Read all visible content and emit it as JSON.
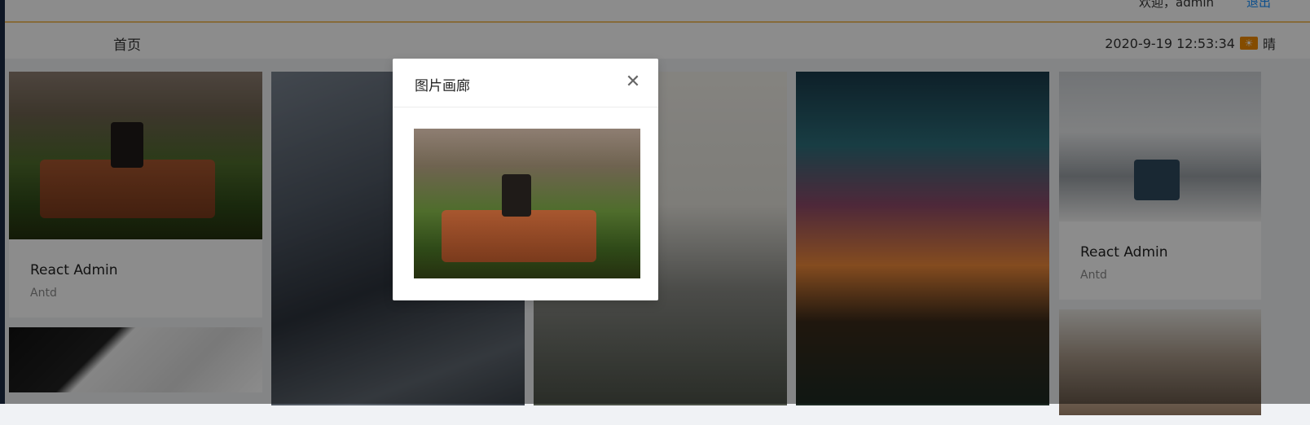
{
  "header": {
    "welcome": "欢迎，admin",
    "logout": "退出"
  },
  "breadcrumb": {
    "label": "首页"
  },
  "status": {
    "datetime": "2020-9-19 12:53:34",
    "weather_icon": "sun-icon",
    "weather_text": "晴"
  },
  "gallery": {
    "cards": [
      {
        "title": "React Admin",
        "desc": "Antd"
      },
      {
        "title": "React Admin",
        "desc": "Antd"
      }
    ]
  },
  "modal": {
    "title": "图片画廊",
    "close_icon": "close-icon"
  },
  "colors": {
    "accent": "#1890ff",
    "header_border": "#f4c36a",
    "weather_badge": "#f08a00"
  }
}
